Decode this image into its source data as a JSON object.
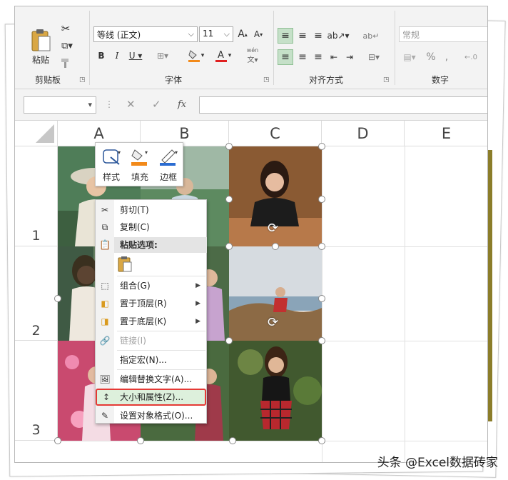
{
  "ribbon": {
    "clipboard": {
      "paste_label": "粘贴",
      "group_label": "剪贴板"
    },
    "font": {
      "font_name": "等线 (正文)",
      "font_size": "11",
      "phonetic_label": "wén",
      "group_label": "字体"
    },
    "alignment": {
      "group_label": "对齐方式"
    },
    "number": {
      "format": "常规",
      "group_label": "数字"
    }
  },
  "formula_bar": {
    "name_box": "",
    "fx_label": "fx",
    "content": ""
  },
  "grid": {
    "columns": [
      "A",
      "B",
      "C",
      "D",
      "E"
    ],
    "rows": [
      "1",
      "2",
      "3"
    ]
  },
  "mini_toolbar": {
    "style_label": "样式",
    "fill_label": "填充",
    "border_label": "边框"
  },
  "context_menu": {
    "cut": "剪切(T)",
    "copy": "复制(C)",
    "paste_options": "粘贴选项:",
    "group": "组合(G)",
    "bring_front": "置于顶层(R)",
    "send_back": "置于底层(K)",
    "link": "链接(I)",
    "assign_macro": "指定宏(N)...",
    "alt_text": "编辑替换文字(A)...",
    "size_props": "大小和属性(Z)...",
    "format_object": "设置对象格式(O)..."
  },
  "watermark": "头条 @Excel数据砖家",
  "colors": {
    "highlight_border": "#e53935",
    "highlight_fill": "#ddf0dc",
    "ribbon_bg": "#f3f3f3"
  }
}
